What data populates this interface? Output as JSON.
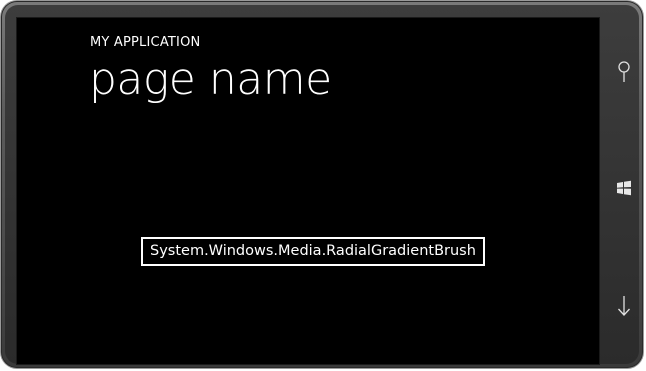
{
  "app": {
    "title": "MY APPLICATION",
    "page_name": "page name"
  },
  "content": {
    "brush_type": "System.Windows.Media.RadialGradientBrush"
  },
  "hardware_buttons": [
    {
      "name": "search",
      "icon": "search-icon"
    },
    {
      "name": "start",
      "icon": "windows-logo-icon"
    },
    {
      "name": "back",
      "icon": "back-arrow-icon"
    }
  ],
  "colors": {
    "screen_background": "#000000",
    "foreground": "#ffffff",
    "device_bezel": "#4a4a4a"
  }
}
